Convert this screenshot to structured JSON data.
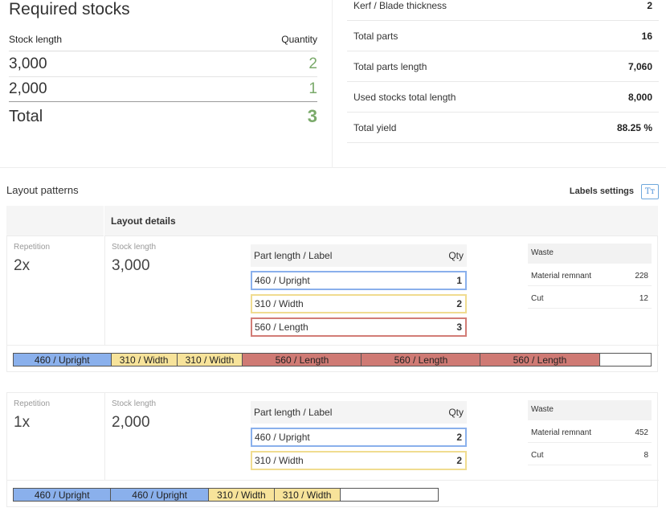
{
  "required_stocks": {
    "title": "Required stocks",
    "col_stock_length": "Stock length",
    "col_quantity": "Quantity",
    "rows": [
      {
        "length": "3,000",
        "qty": "2"
      },
      {
        "length": "2,000",
        "qty": "1"
      }
    ],
    "total_label": "Total",
    "total_qty": "3"
  },
  "stats": [
    {
      "label": "Kerf / Blade thickness",
      "value": "2"
    },
    {
      "label": "Total parts",
      "value": "16"
    },
    {
      "label": "Total parts length",
      "value": "7,060"
    },
    {
      "label": "Used stocks total length",
      "value": "8,000"
    },
    {
      "label": "Total yield",
      "value": "88.25 %"
    }
  ],
  "layout": {
    "title": "Layout patterns",
    "labels_settings": "Labels settings",
    "labels_icon_glyph": "Tт",
    "details_header": "Layout details"
  },
  "colors": {
    "blue": "#8ab0ec",
    "yellow": "#f7e39a",
    "red": "#cf7a74",
    "green": "#7aaa6a"
  },
  "patterns": [
    {
      "repetition_label": "Repetition",
      "repetition": "2x",
      "stock_length_label": "Stock length",
      "stock_length": "3,000",
      "parts_header_label": "Part length / Label",
      "parts_header_qty": "Qty",
      "parts": [
        {
          "label": "460 / Upright",
          "qty": "1",
          "color": "blue"
        },
        {
          "label": "310 / Width",
          "qty": "2",
          "color": "yellow"
        },
        {
          "label": "560 / Length",
          "qty": "3",
          "color": "red"
        }
      ],
      "waste_header": "Waste",
      "waste": [
        {
          "label": "Material remnant",
          "value": "228"
        },
        {
          "label": "Cut",
          "value": "12"
        }
      ],
      "bar": [
        {
          "label": "460 / Upright",
          "color": "blue",
          "length": 460
        },
        {
          "label": "310 / Width",
          "color": "yellow",
          "length": 310
        },
        {
          "label": "310 / Width",
          "color": "yellow",
          "length": 310
        },
        {
          "label": "560 / Length",
          "color": "red",
          "length": 560
        },
        {
          "label": "560 / Length",
          "color": "red",
          "length": 560
        },
        {
          "label": "560 / Length",
          "color": "red",
          "length": 560
        },
        {
          "label": "",
          "color": "waste",
          "length": 240
        }
      ]
    },
    {
      "repetition_label": "Repetition",
      "repetition": "1x",
      "stock_length_label": "Stock length",
      "stock_length": "2,000",
      "parts_header_label": "Part length / Label",
      "parts_header_qty": "Qty",
      "parts": [
        {
          "label": "460 / Upright",
          "qty": "2",
          "color": "blue"
        },
        {
          "label": "310 / Width",
          "qty": "2",
          "color": "yellow"
        }
      ],
      "waste_header": "Waste",
      "waste": [
        {
          "label": "Material remnant",
          "value": "452"
        },
        {
          "label": "Cut",
          "value": "8"
        }
      ],
      "bar": [
        {
          "label": "460 / Upright",
          "color": "blue",
          "length": 460
        },
        {
          "label": "460 / Upright",
          "color": "blue",
          "length": 460
        },
        {
          "label": "310 / Width",
          "color": "yellow",
          "length": 310
        },
        {
          "label": "310 / Width",
          "color": "yellow",
          "length": 310
        },
        {
          "label": "",
          "color": "waste",
          "length": 460
        }
      ]
    }
  ]
}
